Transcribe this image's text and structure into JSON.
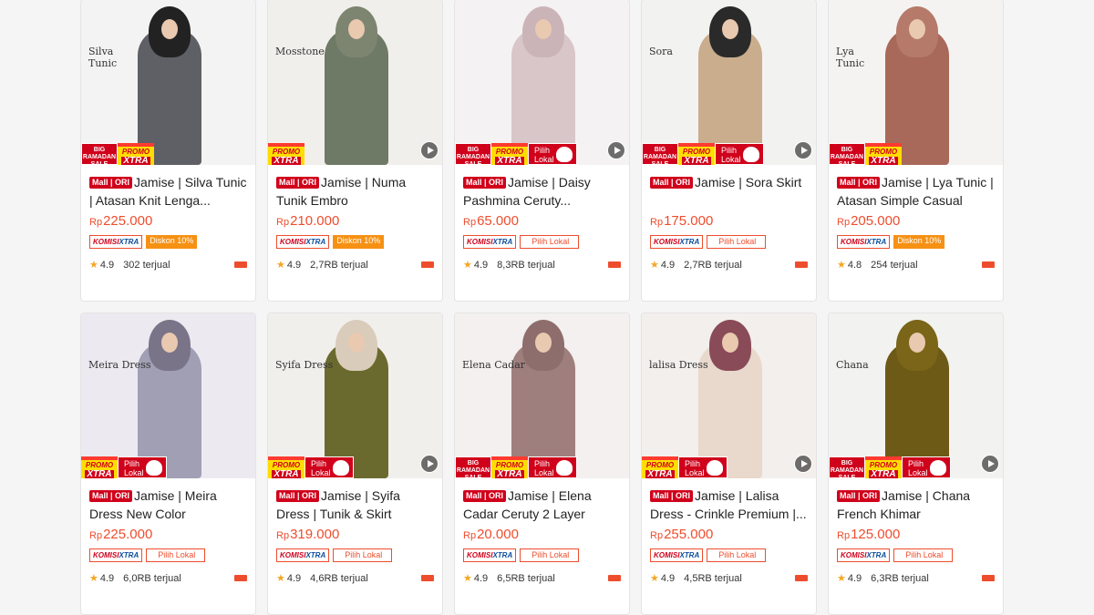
{
  "products": [
    {
      "title": "Jamise | Silva Tunic | Atasan Knit Lenga...",
      "price": "225.000",
      "rating": "4.9",
      "sold": "302 terjual",
      "tags": [
        "komisi",
        "diskon"
      ],
      "badges": [
        "big",
        "promo"
      ],
      "video": false,
      "overlay": "Silva\nTunic",
      "bg": "#f3f3f3",
      "figure": "#5f5f66",
      "scarf": "#222222"
    },
    {
      "title": "Jamise | Numa Tunik Embro",
      "price": "210.000",
      "rating": "4.9",
      "sold": "2,7RB terjual",
      "tags": [
        "komisi",
        "diskon"
      ],
      "badges": [
        "promo"
      ],
      "video": true,
      "overlay": "Mosstone",
      "bg": "#f1efec",
      "figure": "#6f7a66",
      "scarf": "#7d8571"
    },
    {
      "title": "Jamise | Daisy Pashmina Ceruty...",
      "price": "65.000",
      "rating": "4.9",
      "sold": "8,3RB terjual",
      "tags": [
        "komisi",
        "lokal"
      ],
      "badges": [
        "big",
        "promo",
        "lokal"
      ],
      "video": true,
      "overlay": "",
      "bg": "#f4f2f2",
      "figure": "#d9c6c9",
      "scarf": "#cbb4b8"
    },
    {
      "title": "Jamise | Sora Skirt",
      "price": "175.000",
      "rating": "4.9",
      "sold": "2,7RB terjual",
      "tags": [
        "komisi",
        "lokal"
      ],
      "badges": [
        "big",
        "promo",
        "lokal"
      ],
      "video": true,
      "overlay": "Sora",
      "bg": "#f2f2f0",
      "figure": "#c9ad8d",
      "scarf": "#2a2a2a"
    },
    {
      "title": "Jamise | Lya Tunic | Atasan Simple Casual",
      "price": "205.000",
      "rating": "4.8",
      "sold": "254 terjual",
      "tags": [
        "komisi",
        "diskon"
      ],
      "badges": [
        "big",
        "promo"
      ],
      "video": false,
      "overlay": "Lya\nTunic",
      "bg": "#f4f3f2",
      "figure": "#a8695a",
      "scarf": "#b57a69"
    },
    {
      "title": "Jamise | Meira Dress New Color",
      "price": "225.000",
      "rating": "4.9",
      "sold": "6,0RB terjual",
      "tags": [
        "komisi",
        "lokal"
      ],
      "badges": [
        "promo",
        "lokal"
      ],
      "video": false,
      "overlay": "Meira Dress",
      "bg": "#eceaf0",
      "figure": "#a09fb4",
      "scarf": "#7a7489"
    },
    {
      "title": "Jamise | Syifa Dress | Tunik & Skirt",
      "price": "319.000",
      "rating": "4.9",
      "sold": "4,6RB terjual",
      "tags": [
        "komisi",
        "lokal"
      ],
      "badges": [
        "promo",
        "lokal"
      ],
      "video": true,
      "overlay": "Syifa Dress",
      "bg": "#f1efec",
      "figure": "#6b6a2e",
      "scarf": "#d9ccbb"
    },
    {
      "title": "Jamise | Elena Cadar Ceruty 2 Layer",
      "price": "20.000",
      "rating": "4.9",
      "sold": "6,5RB terjual",
      "tags": [
        "komisi",
        "lokal"
      ],
      "badges": [
        "big",
        "promo",
        "lokal"
      ],
      "video": false,
      "overlay": "Elena Cadar",
      "bg": "#f3f0ef",
      "figure": "#9f7f7d",
      "scarf": "#8d6e6d"
    },
    {
      "title": "Jamise | Lalisa Dress - Crinkle Premium |...",
      "price": "255.000",
      "rating": "4.9",
      "sold": "4,5RB terjual",
      "tags": [
        "komisi",
        "lokal"
      ],
      "badges": [
        "promo",
        "lokal"
      ],
      "video": true,
      "overlay": "lalisa Dress",
      "bg": "#f3efec",
      "figure": "#e8d9cc",
      "scarf": "#8a4b58"
    },
    {
      "title": "Jamise | Chana French Khimar",
      "price": "125.000",
      "rating": "4.9",
      "sold": "6,3RB terjual",
      "tags": [
        "komisi",
        "lokal"
      ],
      "badges": [
        "big",
        "promo",
        "lokal"
      ],
      "video": true,
      "overlay": "Chana",
      "bg": "#f2f2f0",
      "figure": "#6d5a16",
      "scarf": "#7a6518"
    }
  ],
  "labels": {
    "mall": "Mall",
    "ori": "ORI",
    "currency": "Rp",
    "komisi_a": "KOMISI",
    "komisi_b": "XTRA",
    "diskon": "Diskon 10%",
    "lokal_tag": "Pilih Lokal",
    "badge_big": "BIG RAMADAN SALE",
    "badge_promo": "PROMO",
    "badge_xtra": "XTRA",
    "badge_lokal": "Pilih Lokal"
  }
}
